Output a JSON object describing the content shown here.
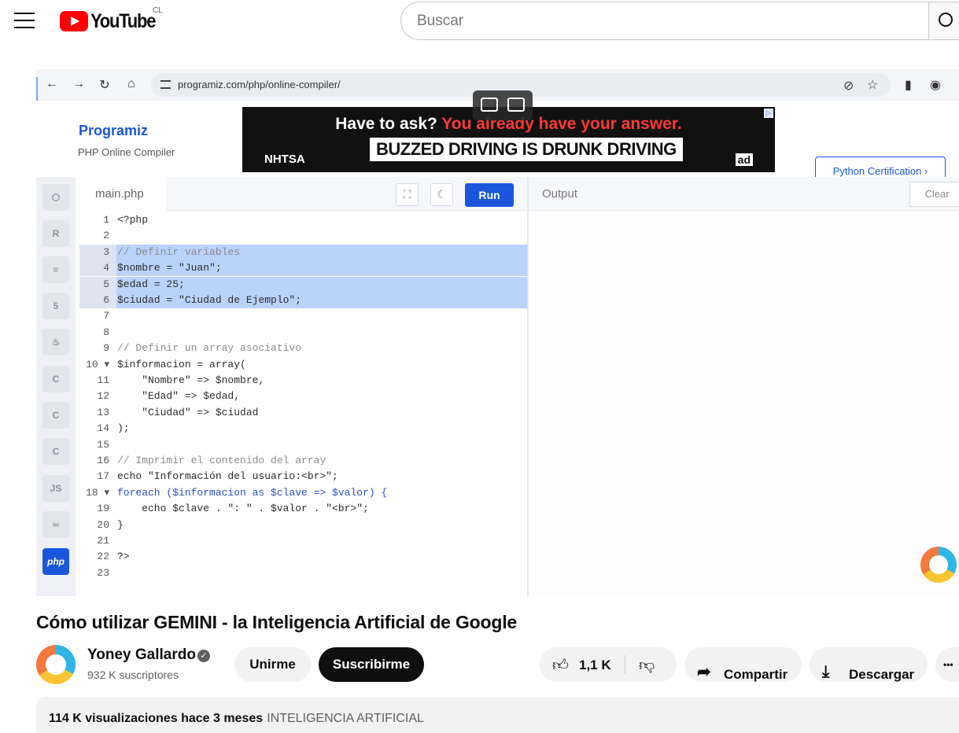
{
  "header": {
    "logo_text": "YouTube",
    "country": "CL",
    "search_placeholder": "Buscar"
  },
  "video": {
    "browser": {
      "url": "programiz.com/php/online-compiler/"
    },
    "programiz": {
      "logo": "Programiz",
      "subtitle": "PHP Online Compiler",
      "ad_line1_a": "Have to ask?",
      "ad_line1_b": "You already have your answer.",
      "ad_line2": "BUZZED DRIVING IS DRUNK DRIVING",
      "ad_brand": "NHTSA",
      "ad_badge": "ad",
      "cert_button": "Python Certification ›"
    },
    "sidebar": {
      "items": [
        "JS",
        "php"
      ]
    },
    "editor": {
      "tab": "main.php",
      "run_label": "Run",
      "output_title": "Output",
      "clear_label": "Clear",
      "lines": [
        {
          "n": "1",
          "t": "<?php"
        },
        {
          "n": "2",
          "t": ""
        },
        {
          "n": "3",
          "t": "// Definir variables"
        },
        {
          "n": "4",
          "t": "$nombre = \"Juan\";"
        },
        {
          "n": "5",
          "t": "$edad = 25;"
        },
        {
          "n": "6",
          "t": "$ciudad = \"Ciudad de Ejemplo\";"
        },
        {
          "n": "7",
          "t": ""
        },
        {
          "n": "8",
          "t": ""
        },
        {
          "n": "9",
          "t": "// Definir un array asociativo"
        },
        {
          "n": "10 ▾",
          "t": "$informacion = array("
        },
        {
          "n": "11",
          "t": "    \"Nombre\" => $nombre,"
        },
        {
          "n": "12",
          "t": "    \"Edad\" => $edad,"
        },
        {
          "n": "13",
          "t": "    \"Ciudad\" => $ciudad"
        },
        {
          "n": "14",
          "t": ");"
        },
        {
          "n": "15",
          "t": ""
        },
        {
          "n": "16",
          "t": "// Imprimir el contenido del array"
        },
        {
          "n": "17",
          "t": "echo \"Información del usuario:<br>\";"
        },
        {
          "n": "18 ▾",
          "t": "foreach ($informacion as $clave => $valor) {"
        },
        {
          "n": "19",
          "t": "    echo $clave . \": \" . $valor . \"<br>\";"
        },
        {
          "n": "20",
          "t": "}"
        },
        {
          "n": "21",
          "t": ""
        },
        {
          "n": "22",
          "t": "?>"
        },
        {
          "n": "23",
          "t": ""
        }
      ]
    }
  },
  "meta": {
    "title": "Cómo utilizar GEMINI - la Inteligencia Artificial de Google",
    "channel": "Yoney Gallardo",
    "subscribers": "932 K suscriptores",
    "join_label": "Unirme",
    "subscribe_label": "Suscribirme",
    "likes": "1,1 K",
    "share_label": "Compartir",
    "download_label": "Descargar",
    "more_label": "•••",
    "views": "114 K visualizaciones",
    "date": "hace 3 meses",
    "tag": "INTELIGENCIA ARTIFICIAL"
  }
}
